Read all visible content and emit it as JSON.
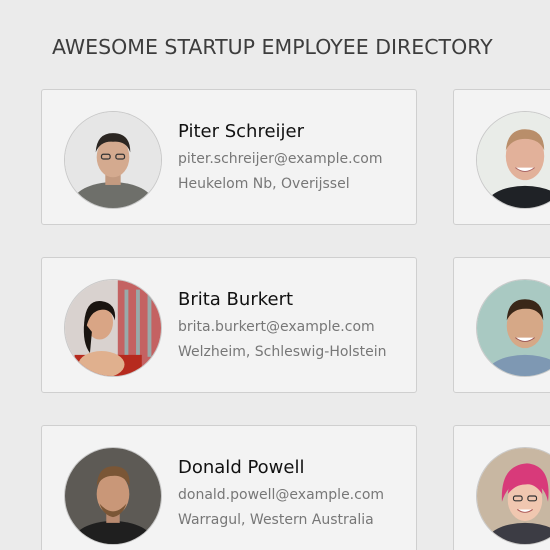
{
  "page": {
    "title": "AWESOME STARTUP EMPLOYEE DIRECTORY"
  },
  "employees": [
    {
      "name": "Piter Schreijer",
      "email": "piter.schreijer@example.com",
      "location": "Heukelom Nb, Overijssel"
    },
    {
      "name": "Brita Burkert",
      "email": "brita.burkert@example.com",
      "location": "Welzheim, Schleswig-Holstein"
    },
    {
      "name": "Donald Powell",
      "email": "donald.powell@example.com",
      "location": "Warragul, Western Australia"
    }
  ],
  "colors": {
    "background": "#ebebeb",
    "card": "#f3f3f3",
    "card_border": "#cfcfcf"
  }
}
